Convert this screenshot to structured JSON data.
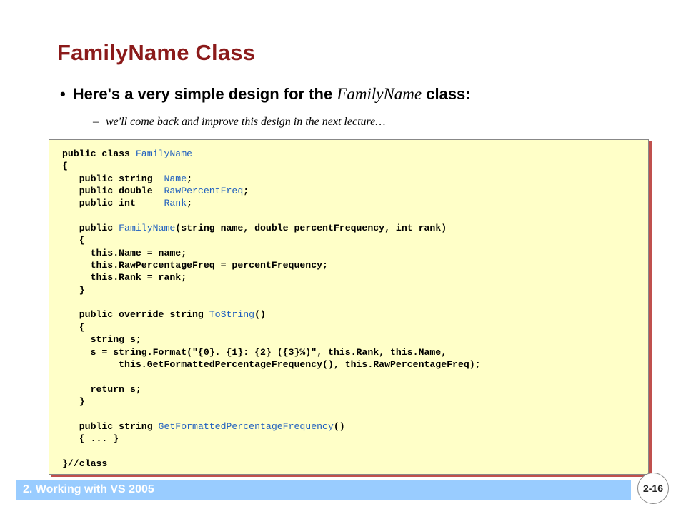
{
  "slide": {
    "title": "FamilyName Class",
    "bullet": {
      "marker": "•",
      "text_before": "Here's a very simple design for the ",
      "class_name": "FamilyName",
      "text_after": " class:"
    },
    "sub_bullet": {
      "marker": "–",
      "text": "we'll come back and improve this design in the next lecture…"
    },
    "footer": {
      "section": "2. Working with VS 2005",
      "page": "2-16"
    },
    "colors": {
      "title": "#8b1a1a",
      "code_background": "#ffffc8",
      "code_shadow": "#c0504d",
      "identifier": "#1f5fbf",
      "footer_bar": "#99ccff"
    }
  },
  "code_lines": [
    [
      {
        "t": "public class "
      },
      {
        "t": "FamilyName",
        "id": true
      }
    ],
    [
      {
        "t": "{"
      }
    ],
    [
      {
        "t": "   public string  "
      },
      {
        "t": "Name",
        "id": true
      },
      {
        "t": ";"
      }
    ],
    [
      {
        "t": "   public double  "
      },
      {
        "t": "RawPercentFreq",
        "id": true
      },
      {
        "t": ";"
      }
    ],
    [
      {
        "t": "   public int     "
      },
      {
        "t": "Rank",
        "id": true
      },
      {
        "t": ";"
      }
    ],
    [
      {
        "t": ""
      }
    ],
    [
      {
        "t": "   public "
      },
      {
        "t": "FamilyName",
        "id": true
      },
      {
        "t": "(string name, double percentFrequency, int rank)"
      }
    ],
    [
      {
        "t": "   {"
      }
    ],
    [
      {
        "t": "     this.Name = name;"
      }
    ],
    [
      {
        "t": "     this.RawPercentageFreq = percentFrequency;"
      }
    ],
    [
      {
        "t": "     this.Rank = rank;"
      }
    ],
    [
      {
        "t": "   }"
      }
    ],
    [
      {
        "t": ""
      }
    ],
    [
      {
        "t": "   public override string "
      },
      {
        "t": "ToString",
        "id": true
      },
      {
        "t": "()"
      }
    ],
    [
      {
        "t": "   {"
      }
    ],
    [
      {
        "t": "     string s;"
      }
    ],
    [
      {
        "t": "     s = string.Format(\"{0}. {1}: {2} ({3}%)\", this.Rank, this.Name,"
      }
    ],
    [
      {
        "t": "          this.GetFormattedPercentageFrequency(), this.RawPercentageFreq);"
      }
    ],
    [
      {
        "t": ""
      }
    ],
    [
      {
        "t": "     return s;"
      }
    ],
    [
      {
        "t": "   }"
      }
    ],
    [
      {
        "t": ""
      }
    ],
    [
      {
        "t": "   public string "
      },
      {
        "t": "GetFormattedPercentageFrequency",
        "id": true
      },
      {
        "t": "()"
      }
    ],
    [
      {
        "t": "   { ... }"
      }
    ],
    [
      {
        "t": ""
      }
    ],
    [
      {
        "t": "}//class"
      }
    ]
  ]
}
